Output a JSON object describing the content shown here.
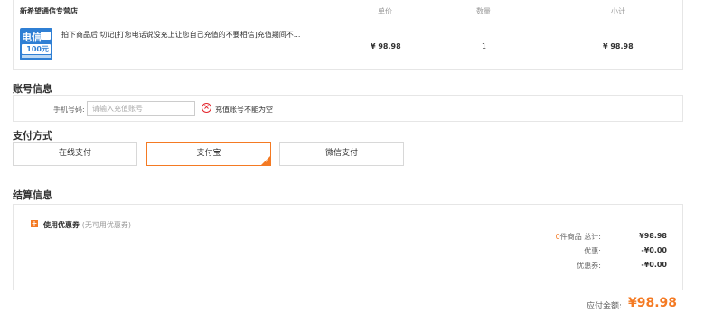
{
  "order": {
    "shop_name": "新希望通信专营店",
    "col_unit_price": "单价",
    "col_quantity": "数量",
    "col_subtotal": "小计",
    "product": {
      "thumb_text": "电信",
      "thumb_amount": "100元",
      "title": "拍下商品后 切记[打您电话说没充上让您自己充值的不要相信]充值期间不...",
      "unit_price": "¥ 98.98",
      "quantity": "1",
      "subtotal": "¥ 98.98"
    }
  },
  "account": {
    "section_title": "账号信息",
    "phone_label": "手机号码:",
    "phone_placeholder": "请输入充值账号",
    "phone_value": "",
    "error_icon": "close-circle-icon",
    "error_text": "充值账号不能为空"
  },
  "payment": {
    "section_title": "支付方式",
    "methods": [
      {
        "label": "在线支付",
        "selected": false
      },
      {
        "label": "支付宝",
        "selected": true
      },
      {
        "label": "微信支付",
        "selected": false
      }
    ]
  },
  "settlement": {
    "section_title": "结算信息",
    "coupon_label": "使用优惠券",
    "coupon_note": "(无可用优惠券)",
    "item_count": "0",
    "items_total_label": "件商品 总计:",
    "items_total": "¥98.98",
    "discount_label": "优惠:",
    "discount": "-¥0.00",
    "coupon_discount_label": "优惠券:",
    "coupon_discount": "-¥0.00"
  },
  "payable": {
    "label": "应付金额:",
    "amount": "¥98.98"
  },
  "colors": {
    "accent": "#f47a23",
    "error": "#e3262d",
    "border": "#e6e6e6"
  }
}
